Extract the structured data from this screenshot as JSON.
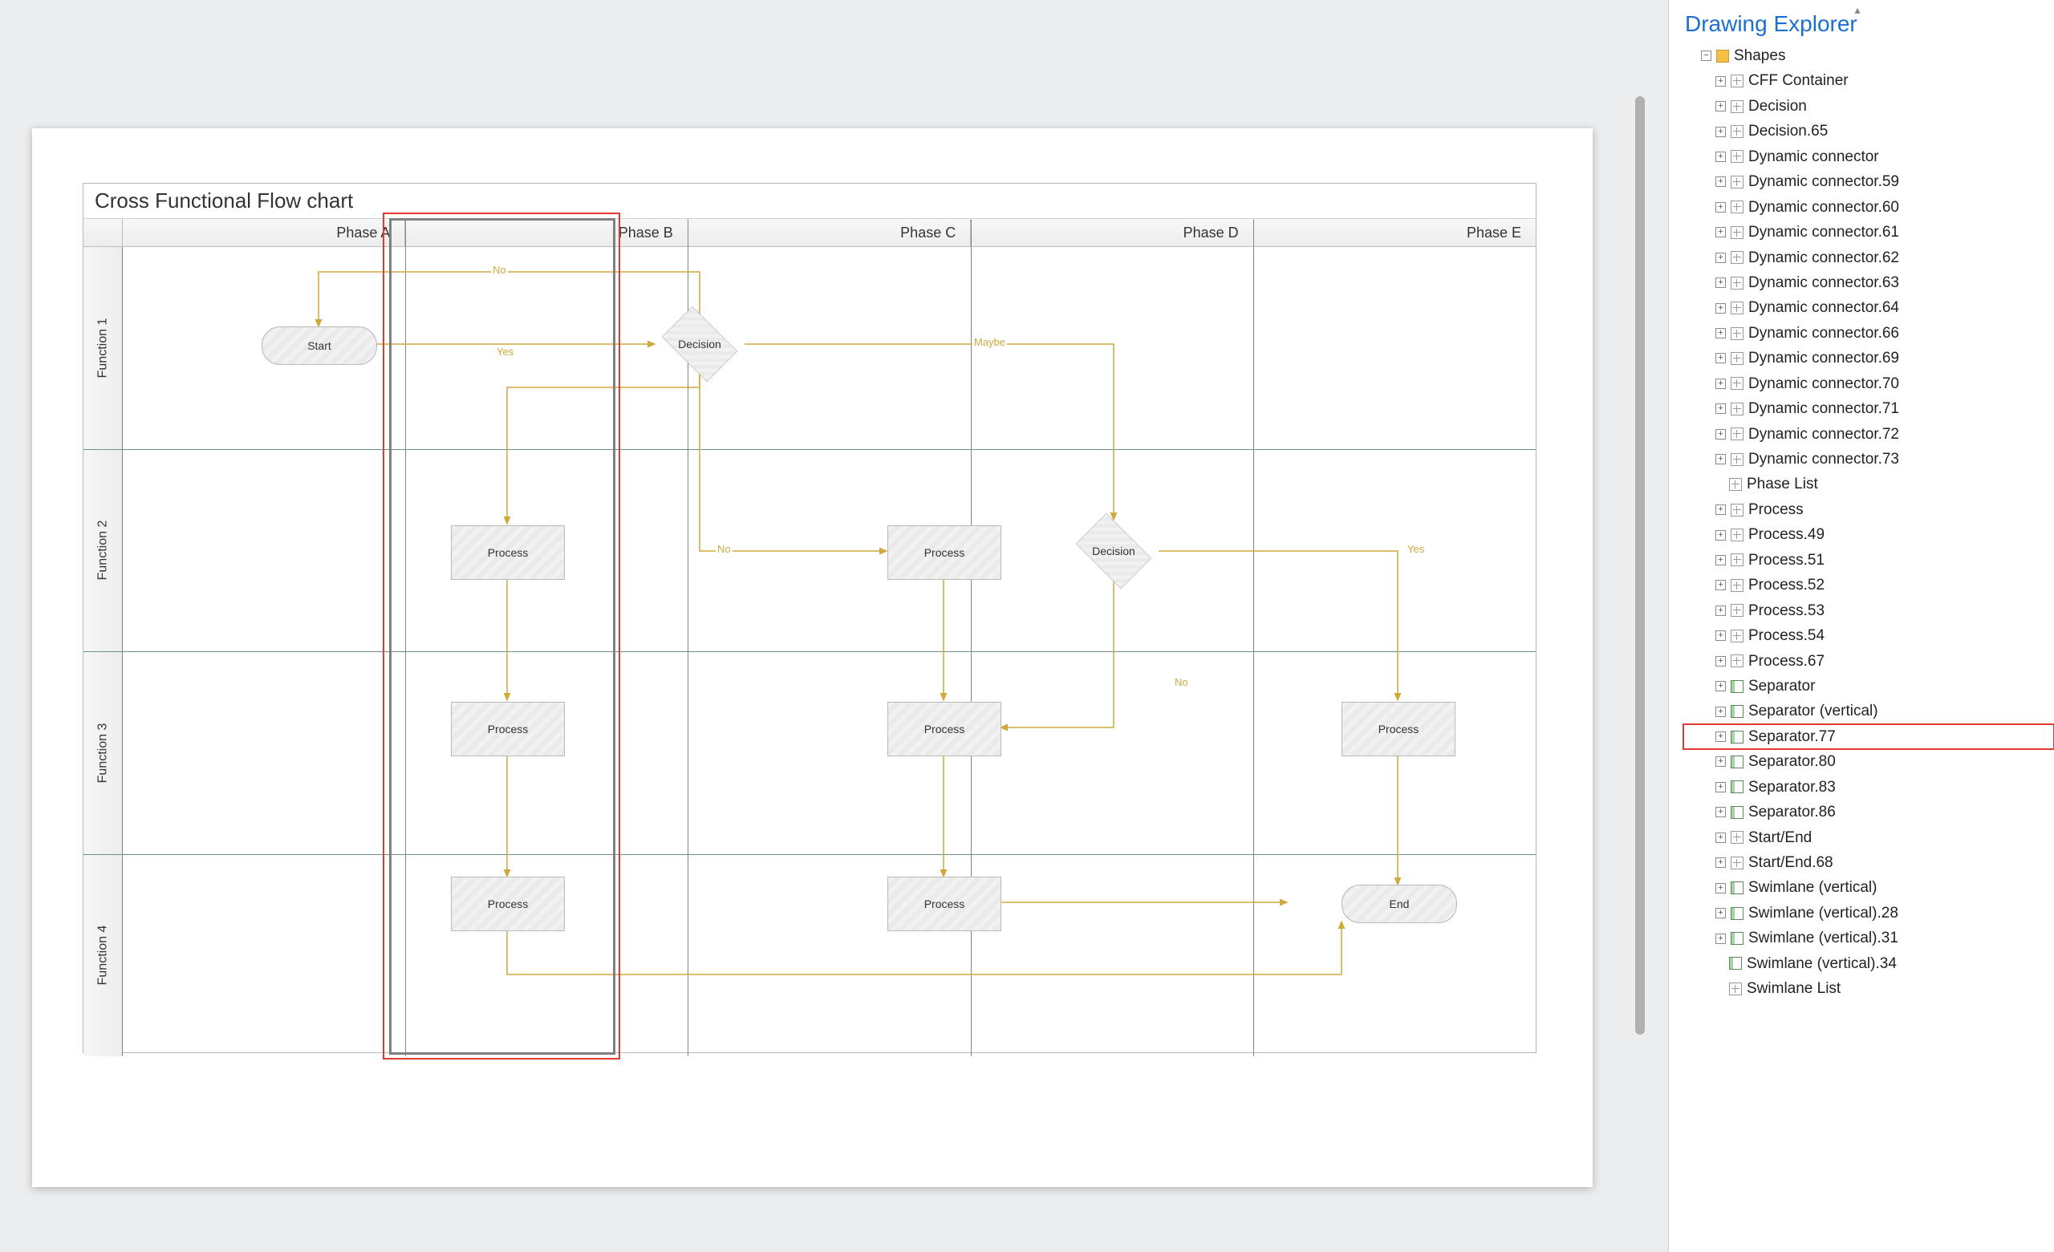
{
  "diagram": {
    "title": "Cross Functional Flow chart",
    "phases": [
      "Phase A",
      "Phase B",
      "Phase C",
      "Phase D",
      "Phase E"
    ],
    "functions": [
      "Function 1",
      "Function 2",
      "Function 3",
      "Function 4"
    ],
    "shapes": {
      "start": {
        "label": "Start"
      },
      "decision1": {
        "label": "Decision"
      },
      "process_b2": {
        "label": "Process"
      },
      "process_b3": {
        "label": "Process"
      },
      "process_b4": {
        "label": "Process"
      },
      "process_d2": {
        "label": "Process"
      },
      "process_d3": {
        "label": "Process"
      },
      "process_d4": {
        "label": "Process"
      },
      "decision2": {
        "label": "Decision"
      },
      "process_e3": {
        "label": "Process"
      },
      "end": {
        "label": "End"
      }
    },
    "connector_labels": {
      "no1": "No",
      "yes1": "Yes",
      "maybe": "Maybe",
      "no2": "No",
      "yes2": "Yes",
      "no3": "No"
    },
    "selected_phase_index": 1
  },
  "explorer": {
    "title": "Drawing Explorer",
    "root": {
      "label": "Shapes"
    },
    "items": [
      {
        "label": "CFF Container",
        "icon": "shape",
        "expandable": true
      },
      {
        "label": "Decision",
        "icon": "shape",
        "expandable": true
      },
      {
        "label": "Decision.65",
        "icon": "shape",
        "expandable": true
      },
      {
        "label": "Dynamic connector",
        "icon": "shape",
        "expandable": true
      },
      {
        "label": "Dynamic connector.59",
        "icon": "shape",
        "expandable": true
      },
      {
        "label": "Dynamic connector.60",
        "icon": "shape",
        "expandable": true
      },
      {
        "label": "Dynamic connector.61",
        "icon": "shape",
        "expandable": true
      },
      {
        "label": "Dynamic connector.62",
        "icon": "shape",
        "expandable": true
      },
      {
        "label": "Dynamic connector.63",
        "icon": "shape",
        "expandable": true
      },
      {
        "label": "Dynamic connector.64",
        "icon": "shape",
        "expandable": true
      },
      {
        "label": "Dynamic connector.66",
        "icon": "shape",
        "expandable": true
      },
      {
        "label": "Dynamic connector.69",
        "icon": "shape",
        "expandable": true
      },
      {
        "label": "Dynamic connector.70",
        "icon": "shape",
        "expandable": true
      },
      {
        "label": "Dynamic connector.71",
        "icon": "shape",
        "expandable": true
      },
      {
        "label": "Dynamic connector.72",
        "icon": "shape",
        "expandable": true
      },
      {
        "label": "Dynamic connector.73",
        "icon": "shape",
        "expandable": true
      },
      {
        "label": "Phase List",
        "icon": "shape",
        "expandable": false
      },
      {
        "label": "Process",
        "icon": "shape",
        "expandable": true
      },
      {
        "label": "Process.49",
        "icon": "shape",
        "expandable": true
      },
      {
        "label": "Process.51",
        "icon": "shape",
        "expandable": true
      },
      {
        "label": "Process.52",
        "icon": "shape",
        "expandable": true
      },
      {
        "label": "Process.53",
        "icon": "shape",
        "expandable": true
      },
      {
        "label": "Process.54",
        "icon": "shape",
        "expandable": true
      },
      {
        "label": "Process.67",
        "icon": "shape",
        "expandable": true
      },
      {
        "label": "Separator",
        "icon": "swim",
        "expandable": true
      },
      {
        "label": "Separator (vertical)",
        "icon": "swim",
        "expandable": true
      },
      {
        "label": "Separator.77",
        "icon": "swim",
        "expandable": true,
        "selected": true
      },
      {
        "label": "Separator.80",
        "icon": "swim",
        "expandable": true
      },
      {
        "label": "Separator.83",
        "icon": "swim",
        "expandable": true
      },
      {
        "label": "Separator.86",
        "icon": "swim",
        "expandable": true
      },
      {
        "label": "Start/End",
        "icon": "shape",
        "expandable": true
      },
      {
        "label": "Start/End.68",
        "icon": "shape",
        "expandable": true
      },
      {
        "label": "Swimlane (vertical)",
        "icon": "swim",
        "expandable": true
      },
      {
        "label": "Swimlane (vertical).28",
        "icon": "swim",
        "expandable": true
      },
      {
        "label": "Swimlane (vertical).31",
        "icon": "swim",
        "expandable": true
      },
      {
        "label": "Swimlane (vertical).34",
        "icon": "swim",
        "expandable": false
      },
      {
        "label": "Swimlane List",
        "icon": "shape",
        "expandable": false
      }
    ]
  }
}
